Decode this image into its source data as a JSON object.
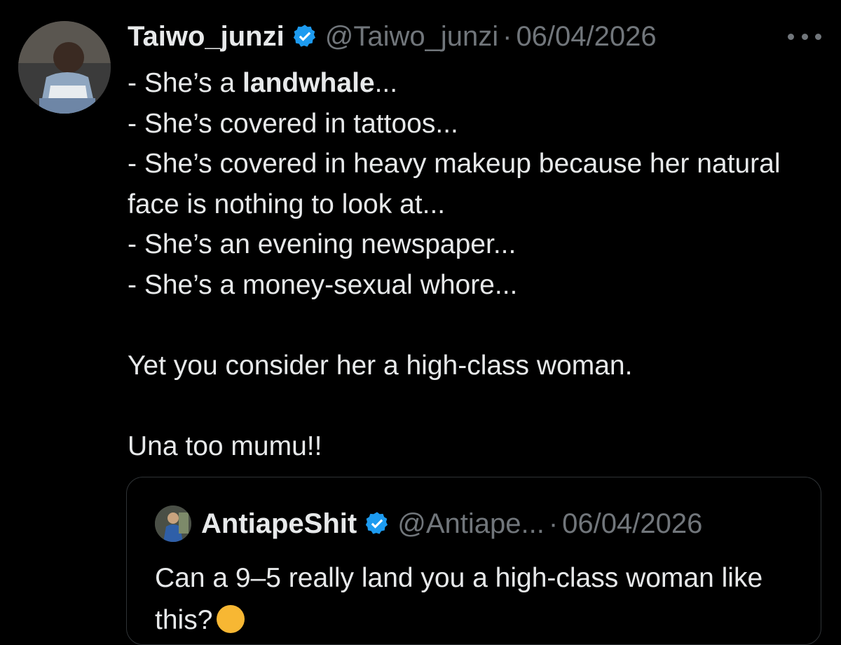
{
  "tweet": {
    "author_name": "Taiwo_junzi",
    "handle": "@Taiwo_junzi",
    "separator": "·",
    "date": "06/04/2026",
    "more_icon": "more-dots-icon",
    "verified_icon": "verified-badge-icon",
    "lines": {
      "l1_prefix": "- She’s a ",
      "l1_bold": "landwhale",
      "l1_suffix": "...",
      "l2": "- She’s covered in tattoos...",
      "l3": "- She’s covered in heavy makeup because her natural face is nothing to look at...",
      "l4": "- She’s an evening newspaper...",
      "l5": "- She’s a money-sexual whore...",
      "l6": "Yet you consider her a high-class woman.",
      "l7": "Una too mumu!!"
    }
  },
  "quoted": {
    "author_name": "AntiapeShit",
    "handle": "@Antiape...",
    "separator": "·",
    "date": "06/04/2026",
    "text": "Can a 9–5 really land you a high-class woman like this?"
  },
  "colors": {
    "background": "#000000",
    "text": "#e7e9ea",
    "muted": "#71767b",
    "verified": "#1d9bf0",
    "border": "#2f3336"
  }
}
